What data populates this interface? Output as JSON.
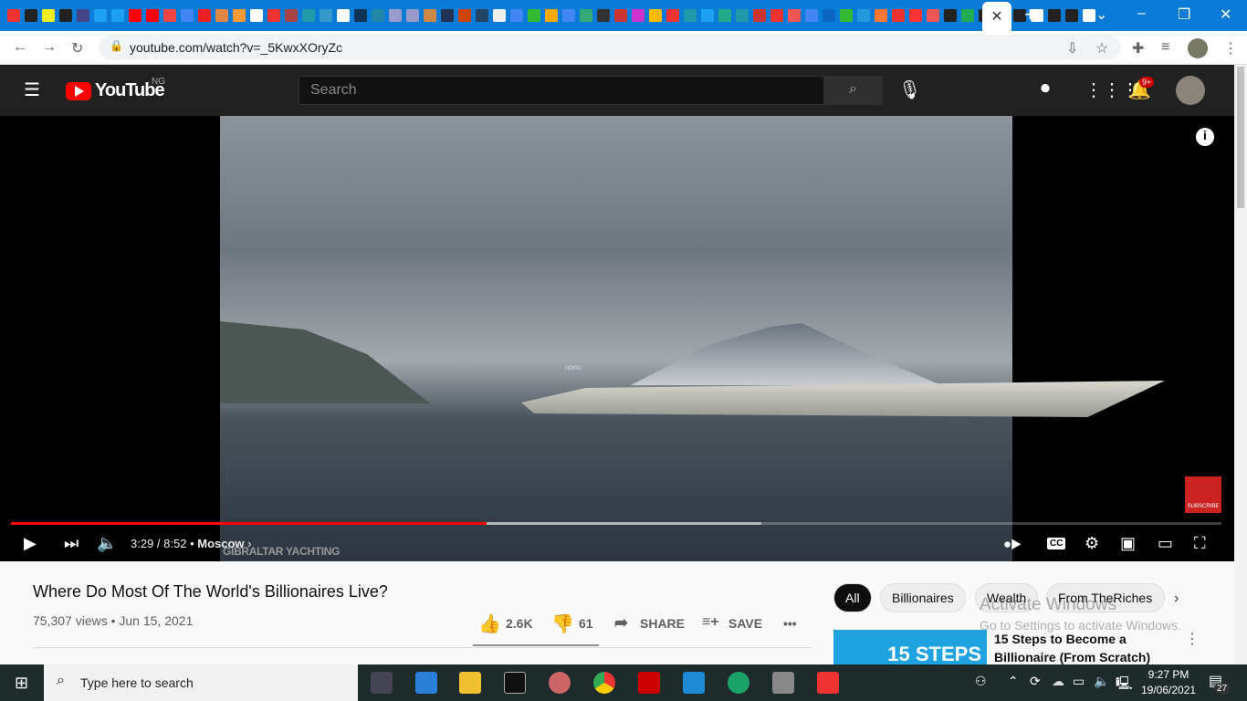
{
  "browser": {
    "url": "youtube.com/watch?v=_5KwxXOryZc",
    "new_tab": "+",
    "close_tab": "✕",
    "favicon_colors": [
      "#e33",
      "#222",
      "#ee2",
      "#222",
      "#448",
      "#1da1f2",
      "#1da1f2",
      "#f00",
      "#f00",
      "#e44",
      "#4285f4",
      "#e22",
      "#d84",
      "#f93",
      "#fff",
      "#e33",
      "#a44",
      "#29a",
      "#39c",
      "#fff",
      "#135",
      "#28a",
      "#99c",
      "#99c",
      "#c84",
      "#235",
      "#c40",
      "#246",
      "#eee",
      "#4285f4",
      "#3b3",
      "#fa0",
      "#4285f4",
      "#3a7",
      "#333",
      "#c33",
      "#c3c",
      "#fb0",
      "#e33",
      "#29a",
      "#1da1f2",
      "#2a8",
      "#29a",
      "#c33",
      "#e33",
      "#e55",
      "#4285f4",
      "#0a66c2",
      "#3b3",
      "#29d",
      "#f73",
      "#e33",
      "#f33",
      "#e55",
      "#222",
      "#2a5",
      "#222",
      "#e33",
      "#222",
      "#fff",
      "#222",
      "#222",
      "#fff"
    ]
  },
  "youtube": {
    "logo": "YouTube",
    "country": "NG",
    "search_placeholder": "Search",
    "notif_count": "9+"
  },
  "player": {
    "current_time": "3:29",
    "duration": "8:52",
    "time_text": "3:29 / 8:52",
    "chapter": "Moscow",
    "watermark": "GIBRALTAR YACHTING",
    "subscribe_wm": "SUBSCRIBE",
    "progress": 0.393,
    "buffered": 0.62,
    "yacht_name": "NORD",
    "cc": "CC"
  },
  "video": {
    "title": "Where Do Most Of The World's Billionaires Live?",
    "views": "75,307 views",
    "date": "Jun 15, 2021",
    "meta": "75,307 views • Jun 15, 2021",
    "likes": "2.6K",
    "dislikes": "61",
    "share": "SHARE",
    "save": "SAVE"
  },
  "chips": [
    "All",
    "Billionaires",
    "Wealth",
    "From TheRiches"
  ],
  "related": [
    {
      "title_line1": "15 Steps to Become a",
      "title_line2": "Billionaire (From Scratch)",
      "thumb_text": "15 STEPS"
    }
  ],
  "activation": {
    "line1": "Activate Windows",
    "line2": "Go to Settings to activate Windows."
  },
  "taskbar": {
    "search_placeholder": "Type here to search",
    "time": "9:27 PM",
    "date": "19/06/2021",
    "notifications": "27"
  }
}
